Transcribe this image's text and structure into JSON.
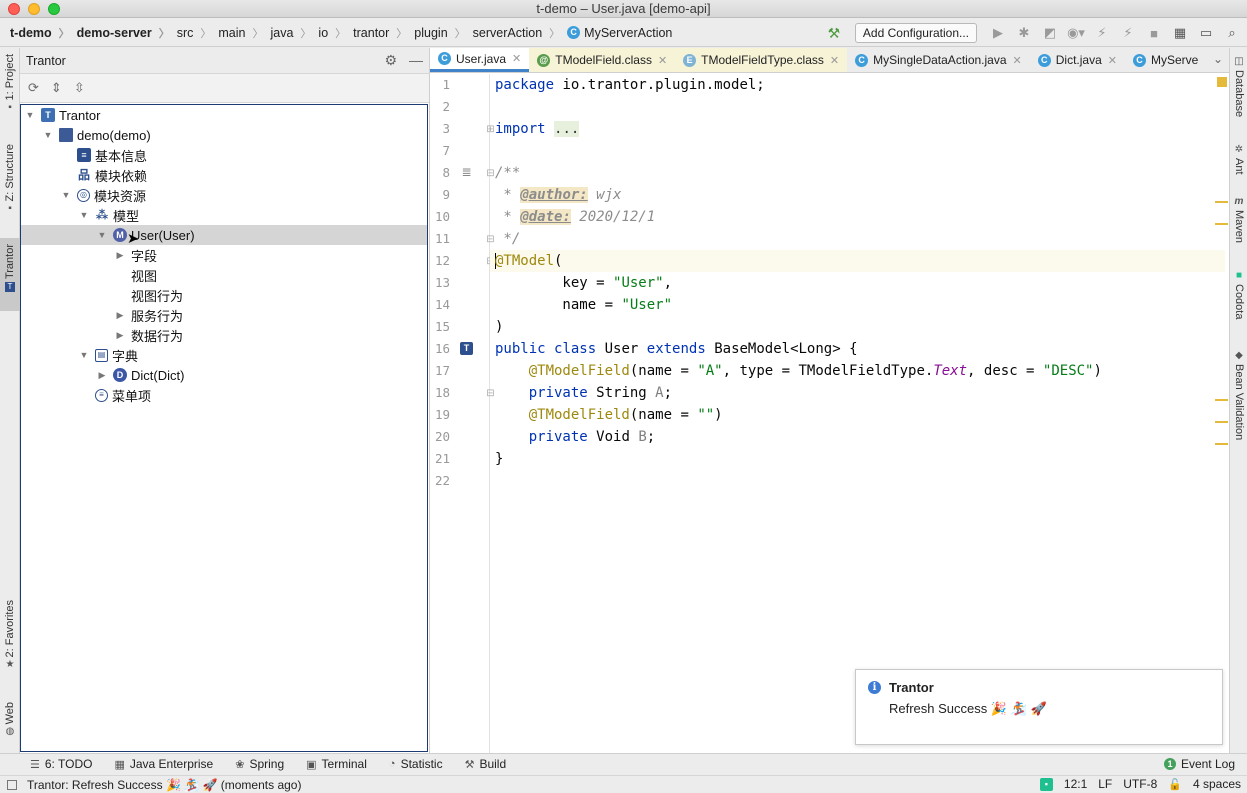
{
  "window": {
    "title": "t-demo – User.java [demo-api]"
  },
  "breadcrumb": [
    {
      "label": "t-demo",
      "bold": true
    },
    {
      "label": "demo-server",
      "bold": true
    },
    {
      "label": "src"
    },
    {
      "label": "main"
    },
    {
      "label": "java"
    },
    {
      "label": "io"
    },
    {
      "label": "trantor"
    },
    {
      "label": "plugin"
    },
    {
      "label": "serverAction"
    },
    {
      "label": "MyServerAction",
      "icon": "C"
    }
  ],
  "toolbar": {
    "add_config_label": "Add Configuration..."
  },
  "left_stripe": {
    "project": "1: Project",
    "structure": "Z: Structure",
    "trantor": "Trantor",
    "favorites": "2: Favorites",
    "web": "Web"
  },
  "tool_window": {
    "title": "Trantor",
    "tree": [
      {
        "label": "Trantor",
        "level": 0,
        "expanded": true,
        "icon": "T"
      },
      {
        "label": "demo(demo)",
        "level": 1,
        "expanded": true,
        "icon": "folder"
      },
      {
        "label": "基本信息",
        "level": 2,
        "icon": "info"
      },
      {
        "label": "模块依赖",
        "level": 2,
        "icon": "dep"
      },
      {
        "label": "模块资源",
        "level": 2,
        "expanded": true,
        "icon": "res"
      },
      {
        "label": "模型",
        "level": 3,
        "expanded": true,
        "icon": "model"
      },
      {
        "label": "User(User)",
        "level": 4,
        "expanded": true,
        "icon": "M",
        "selected": true
      },
      {
        "label": "字段",
        "level": 5,
        "collapsed": true
      },
      {
        "label": "视图",
        "level": 5
      },
      {
        "label": "视图行为",
        "level": 5
      },
      {
        "label": "服务行为",
        "level": 5,
        "collapsed": true
      },
      {
        "label": "数据行为",
        "level": 5,
        "collapsed": true
      },
      {
        "label": "字典",
        "level": 3,
        "expanded": true,
        "icon": "dict"
      },
      {
        "label": "Dict(Dict)",
        "level": 4,
        "collapsed": true,
        "icon": "D"
      },
      {
        "label": "菜单项",
        "level": 3,
        "icon": "menu"
      }
    ]
  },
  "editor_tabs": [
    {
      "label": "User.java",
      "icon": "C",
      "active": true
    },
    {
      "label": "TModelField.class",
      "icon": "@",
      "cls": true
    },
    {
      "label": "TModelFieldType.class",
      "icon": "E",
      "cls": true
    },
    {
      "label": "MySingleDataAction.java",
      "icon": "C"
    },
    {
      "label": "Dict.java",
      "icon": "C"
    },
    {
      "label": "MyServe",
      "icon": "C"
    }
  ],
  "code": {
    "line_numbers": [
      "1",
      "2",
      "3",
      "7",
      "8",
      "9",
      "10",
      "11",
      "12",
      "13",
      "14",
      "15",
      "16",
      "17",
      "18",
      "19",
      "20",
      "21",
      "22"
    ],
    "l1_kw": "package",
    "l1_rest": " io.trantor.plugin.model;",
    "l3_kw": "import",
    "l3_fold": "...",
    "l8": "/**",
    "l9_pre": " * ",
    "l9_tag": "@author:",
    "l9_rest": " wjx",
    "l10_pre": " * ",
    "l10_tag": "@date:",
    "l10_rest": " 2020/12/1",
    "l11": " */",
    "l12_ann": "@TModel",
    "l12_rest": "(",
    "l13_pre": "        key = ",
    "l13_str": "\"User\"",
    "l13_rest": ",",
    "l14_pre": "        name = ",
    "l14_str": "\"User\"",
    "l15": ")",
    "l16_kw1": "public",
    "l16_kw2": "class",
    "l16_name": "User",
    "l16_kw3": "extends",
    "l16_rest": "BaseModel<Long> {",
    "l17_ann": "@TModelField",
    "l17_a": "(name = ",
    "l17_s1": "\"A\"",
    "l17_b": ", type = TModelFieldType.",
    "l17_stat": "Text",
    "l17_c": ", desc = ",
    "l17_s2": "\"DESC\"",
    "l17_d": ")",
    "l18_kw": "private",
    "l18_a": " String ",
    "l18_var": "A",
    "l18_b": ";",
    "l19_ann": "@TModelField",
    "l19_a": "(name = ",
    "l19_s": "\"\"",
    "l19_b": ")",
    "l20_kw": "private",
    "l20_a": " Void ",
    "l20_var": "B",
    "l20_b": ";",
    "l21": "}"
  },
  "right_stripe": {
    "database": "Database",
    "ant": "Ant",
    "maven": "Maven",
    "codota": "Codota",
    "bean_validation": "Bean Validation"
  },
  "notification": {
    "title": "Trantor",
    "body": "Refresh Success 🎉 🏂 🚀"
  },
  "bottom_tabs": [
    {
      "label": "6: TODO",
      "icon": "☰"
    },
    {
      "label": "Java Enterprise",
      "icon": "▦"
    },
    {
      "label": "Spring",
      "icon": "❀"
    },
    {
      "label": "Terminal",
      "icon": "▣"
    },
    {
      "label": "Statistic",
      "icon": "◔"
    },
    {
      "label": "Build",
      "icon": "⚒"
    }
  ],
  "event_log": "Event Log",
  "status": {
    "message": "Trantor: Refresh Success 🎉 🏂 🚀 (moments ago)",
    "position": "12:1",
    "line_sep": "LF",
    "encoding": "UTF-8",
    "indent": "4 spaces"
  }
}
